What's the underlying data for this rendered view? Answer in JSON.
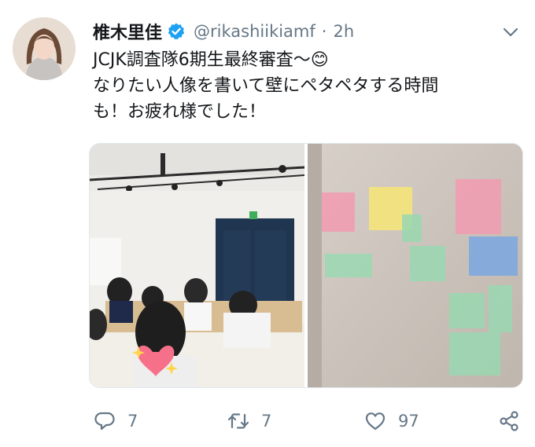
{
  "tweet": {
    "display_name": "椎木里佳",
    "handle": "@rikashiikiamf",
    "separator": "·",
    "time": "2h",
    "text": "JCJK調査隊6期生最終審査〜😊\nなりたい人像を書いて壁にペタペタする時間\nも！お疲れ様でした！",
    "verified": true
  },
  "actions": {
    "reply_count": "7",
    "retweet_count": "7",
    "like_count": "97"
  },
  "colors": {
    "verified_blue": "#1da1f2",
    "muted_gray": "#657786",
    "text_dark": "#14171a"
  },
  "icons": {
    "verified": "verified-badge-icon",
    "more": "chevron-down-icon",
    "reply": "reply-icon",
    "retweet": "retweet-icon",
    "like": "heart-icon",
    "share": "share-icon"
  }
}
